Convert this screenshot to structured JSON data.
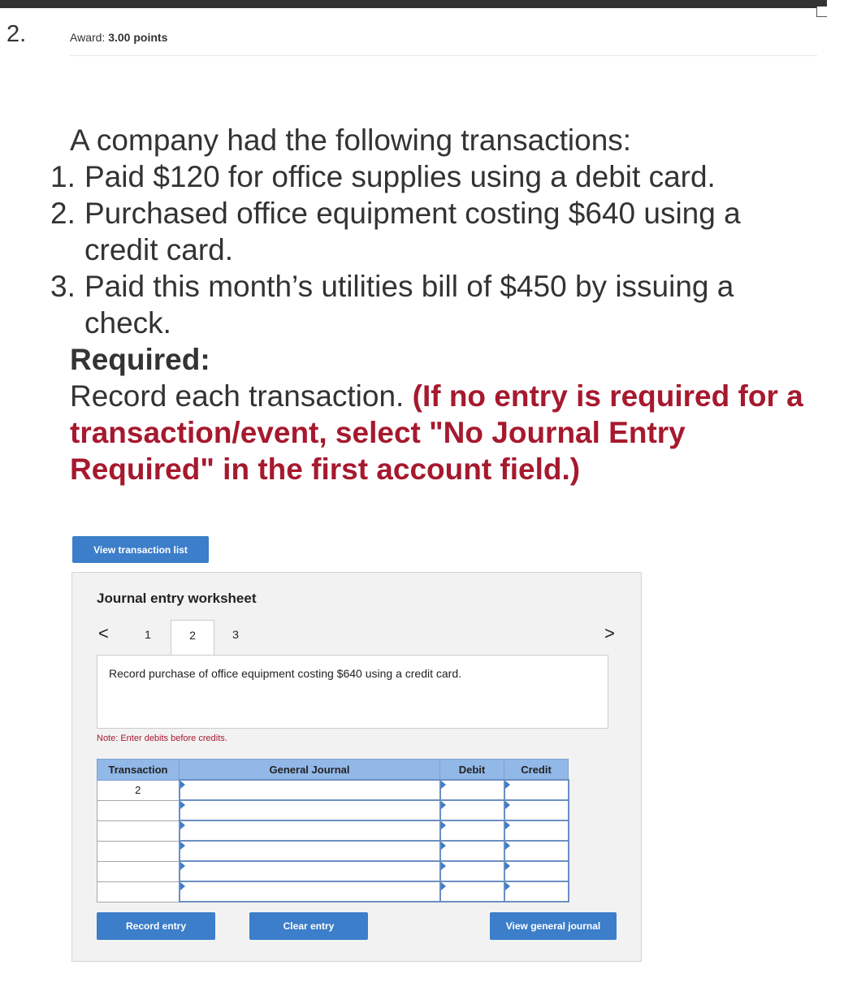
{
  "header": {
    "question_number": "2.",
    "award_label": "Award:",
    "award_value": "3.00 points"
  },
  "question": {
    "intro": "A company had the following transactions:",
    "items": [
      {
        "num": "1.",
        "text": "Paid $120 for office supplies using a debit card."
      },
      {
        "num": "2.",
        "text": "Purchased office equipment costing $640 using a credit card."
      },
      {
        "num": "3.",
        "text": "Paid this month’s utilities bill of $450 by issuing a check."
      }
    ],
    "required_label": "Required:",
    "record_text": "Record each transaction.",
    "record_instruction": "(If no entry is required for a transaction/event, select \"No Journal Entry Required\" in the first account field.)"
  },
  "view_transaction_list_label": "View transaction list",
  "worksheet": {
    "title": "Journal entry worksheet",
    "tabs": [
      "1",
      "2",
      "3"
    ],
    "active_tab": "2",
    "prev_icon": "chevron-left-icon",
    "next_icon": "chevron-right-icon",
    "prev_glyph": "<",
    "next_glyph": ">",
    "description": "Record purchase of office equipment costing $640 using a credit card.",
    "note": "Note: Enter debits before credits.",
    "table": {
      "headers": [
        "Transaction",
        "General Journal",
        "Debit",
        "Credit"
      ],
      "rows": [
        {
          "transaction": "2",
          "account": "",
          "debit": "",
          "credit": ""
        },
        {
          "transaction": "",
          "account": "",
          "debit": "",
          "credit": ""
        },
        {
          "transaction": "",
          "account": "",
          "debit": "",
          "credit": ""
        },
        {
          "transaction": "",
          "account": "",
          "debit": "",
          "credit": ""
        },
        {
          "transaction": "",
          "account": "",
          "debit": "",
          "credit": ""
        },
        {
          "transaction": "",
          "account": "",
          "debit": "",
          "credit": ""
        }
      ]
    },
    "buttons": {
      "record": "Record entry",
      "clear": "Clear entry",
      "view_journal": "View general journal"
    }
  },
  "colors": {
    "accent_blue": "#3c7ec9",
    "header_blue": "#92b8e8",
    "instruction_red": "#a6192e"
  }
}
